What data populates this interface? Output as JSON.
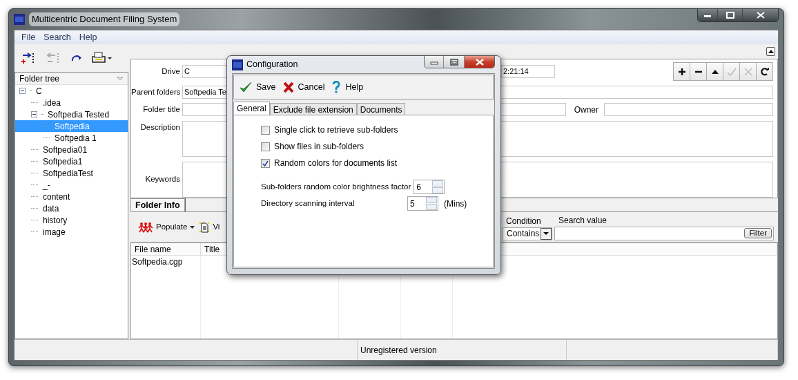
{
  "window": {
    "title": "Multicentric Document Filing System"
  },
  "menu": [
    {
      "label": "File"
    },
    {
      "label": "Search"
    },
    {
      "label": "Help"
    }
  ],
  "left_toolbar": [
    {
      "kind": "add",
      "disabled": false
    },
    {
      "kind": "remove",
      "disabled": true
    },
    {
      "kind": "redo",
      "disabled": false
    },
    {
      "kind": "print",
      "disabled": false
    }
  ],
  "folder_tree": {
    "title": "Folder tree",
    "items": [
      {
        "label": "C",
        "expanded": true,
        "selected": false,
        "children": [
          {
            "label": ".idea",
            "selected": false
          },
          {
            "label": "Softpedia Tested",
            "expanded": true,
            "selected": false,
            "children": [
              {
                "label": "Softpedia",
                "selected": true
              },
              {
                "label": "Softpedia 1",
                "selected": false
              }
            ]
          },
          {
            "label": "Softpedia01",
            "selected": false
          },
          {
            "label": "Softpedia1",
            "selected": false
          },
          {
            "label": "SoftpediaTest",
            "selected": false
          },
          {
            "label": "_-",
            "selected": false
          },
          {
            "label": "content",
            "selected": false
          },
          {
            "label": "data",
            "selected": false
          },
          {
            "label": "history",
            "selected": false
          },
          {
            "label": "image",
            "selected": false
          }
        ]
      }
    ]
  },
  "form": {
    "drive": {
      "label": "Drive",
      "value": "C"
    },
    "time_value": "2:21:14",
    "parent_folders": {
      "label": "Parent folders",
      "value": "Softpedia Te"
    },
    "folder_title": {
      "label": "Folder title"
    },
    "owner": {
      "label": "Owner"
    },
    "description": {
      "label": "Description"
    },
    "keywords": {
      "label": "Keywords"
    }
  },
  "record_buttons": [
    {
      "kind": "add",
      "disabled": false
    },
    {
      "kind": "remove",
      "disabled": false
    },
    {
      "kind": "up",
      "disabled": false
    },
    {
      "kind": "confirm",
      "disabled": true
    },
    {
      "kind": "cancel",
      "disabled": true
    },
    {
      "kind": "refresh",
      "disabled": false
    }
  ],
  "bottom_tabs": [
    {
      "label": "Folder Info",
      "selected": true
    }
  ],
  "files_toolbar": {
    "populate": "Populate",
    "view": "Vi",
    "condition_label": "Condition",
    "condition_value": "Contains",
    "search_label": "Search value",
    "filter": "Filter"
  },
  "file_list": {
    "columns": [
      "File name",
      "Title"
    ],
    "rows": [
      [
        "Softpedia.cgp"
      ]
    ]
  },
  "status_bar": [
    "Unregistered version"
  ],
  "dialog": {
    "title": "Configuration",
    "toolbar": [
      {
        "kind": "save",
        "label": "Save"
      },
      {
        "kind": "cancel",
        "label": "Cancel"
      },
      {
        "kind": "help",
        "label": "Help"
      }
    ],
    "tabs": [
      {
        "label": "General",
        "selected": true
      },
      {
        "label": "Exclude file extension",
        "selected": false
      },
      {
        "label": "Documents",
        "selected": false
      }
    ],
    "options": [
      {
        "label": "Single click to retrieve sub-folders",
        "checked": false
      },
      {
        "label": "Show files in sub-folders",
        "checked": false
      },
      {
        "label": "Random colors for documents list",
        "checked": true
      }
    ],
    "spinners": [
      {
        "label": "Sub-folders random color brightness factor",
        "value": "6"
      },
      {
        "label": "Directory scanning interval",
        "value": "5",
        "unit": "(Mins)"
      }
    ]
  }
}
